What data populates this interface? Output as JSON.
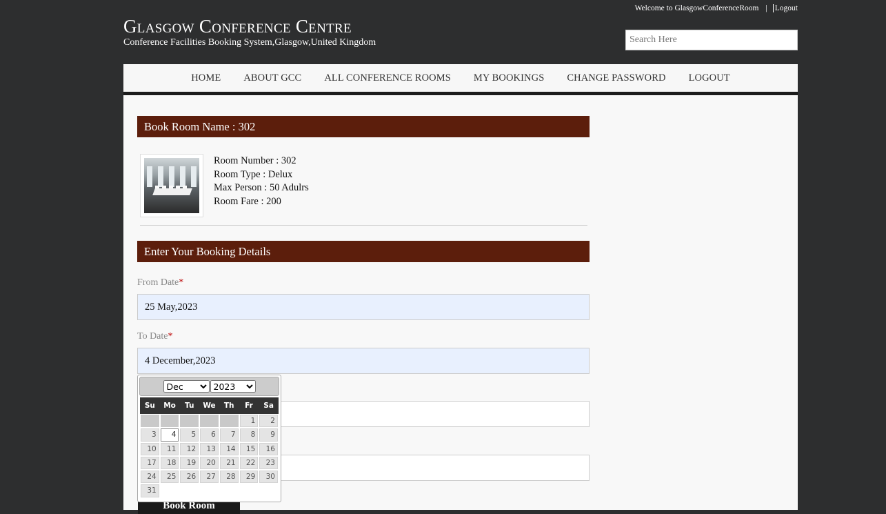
{
  "topbar": {
    "welcome": "Welcome to GlasgowConferenceRoom",
    "separator": "|",
    "logout": "Logout"
  },
  "brand": {
    "title": "Glasgow Conference Centre",
    "subtitle": "Conference Facilities Booking System,Glasgow,United Kingdom"
  },
  "search": {
    "placeholder": "Search Here"
  },
  "nav": [
    "HOME",
    "ABOUT GCC",
    "ALL CONFERENCE ROOMS",
    "MY BOOKINGS",
    "CHANGE PASSWORD",
    "LOGOUT"
  ],
  "room": {
    "header": "Book Room Name : 302",
    "number": "Room Number : 302",
    "type": "Room Type : Delux",
    "max_person": "Max Person : 50 Adulrs",
    "fare": "Room Fare : 200"
  },
  "booking": {
    "header": "Enter Your Booking Details",
    "from_label": "From Date",
    "from_value": "25 May,2023",
    "to_label": "To Date",
    "to_value": "4 December,2023",
    "required_mark": "*",
    "submit": "Book Room"
  },
  "datepicker": {
    "month": "Dec",
    "year": "2023",
    "days_of_week": [
      "Su",
      "Mo",
      "Tu",
      "We",
      "Th",
      "Fr",
      "Sa"
    ],
    "selected_day": "4",
    "weeks": [
      [
        "",
        "",
        "",
        "",
        "",
        "1",
        "2"
      ],
      [
        "3",
        "4",
        "5",
        "6",
        "7",
        "8",
        "9"
      ],
      [
        "10",
        "11",
        "12",
        "13",
        "14",
        "15",
        "16"
      ],
      [
        "17",
        "18",
        "19",
        "20",
        "21",
        "22",
        "23"
      ],
      [
        "24",
        "25",
        "26",
        "27",
        "28",
        "29",
        "30"
      ],
      [
        "31",
        "",
        "",
        "",
        "",
        "",
        ""
      ]
    ]
  }
}
